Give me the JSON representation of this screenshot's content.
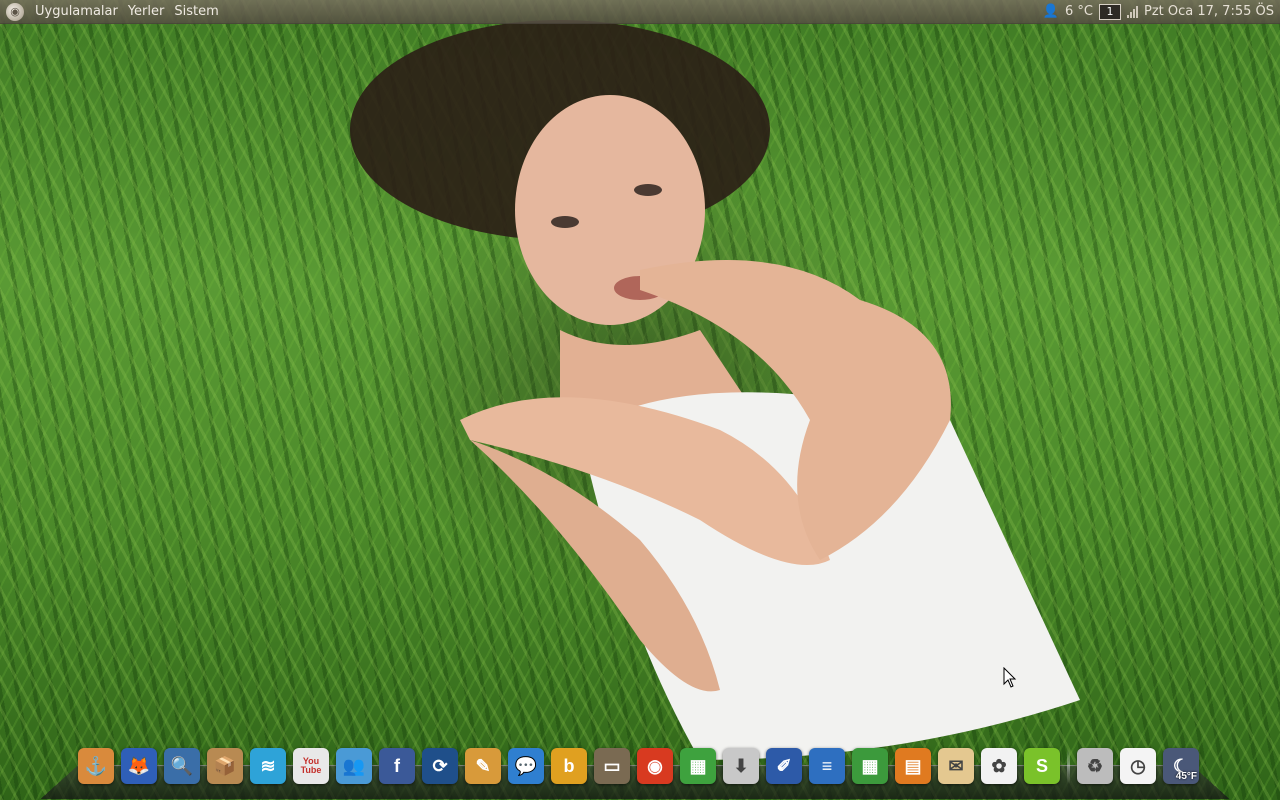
{
  "top_panel": {
    "menus": [
      {
        "label": "Uygulamalar",
        "name": "menu-applications"
      },
      {
        "label": "Yerler",
        "name": "menu-places"
      },
      {
        "label": "Sistem",
        "name": "menu-system"
      }
    ],
    "weather": "6 °C",
    "workspace": "1",
    "clock": "Pzt Oca 17,  7:55 ÖS"
  },
  "dock": {
    "icons": [
      {
        "name": "dock-anchor-icon",
        "glyph": "⚓",
        "color": "#d98a3c"
      },
      {
        "name": "dock-firefox-icon",
        "glyph": "🦊",
        "color": "#2f5fb8"
      },
      {
        "name": "dock-image-search-icon",
        "glyph": "🔍",
        "color": "#3a6ea8"
      },
      {
        "name": "dock-package-icon",
        "glyph": "📦",
        "color": "#b88a52"
      },
      {
        "name": "dock-network-icon",
        "glyph": "≋",
        "color": "#2ea3d8"
      },
      {
        "name": "dock-youtube-icon",
        "glyph": "You Tube",
        "color": "#e8e8e8"
      },
      {
        "name": "dock-messenger-icon",
        "glyph": "👥",
        "color": "#4a9ad6"
      },
      {
        "name": "dock-facebook-icon",
        "glyph": "f",
        "color": "#3b5998"
      },
      {
        "name": "dock-update-icon",
        "glyph": "⟳",
        "color": "#1f4f8a"
      },
      {
        "name": "dock-paint-icon",
        "glyph": "✎",
        "color": "#d89a3a"
      },
      {
        "name": "dock-chat-icon",
        "glyph": "💬",
        "color": "#2f7fd0"
      },
      {
        "name": "dock-bookmark-icon",
        "glyph": "b",
        "color": "#e0a020"
      },
      {
        "name": "dock-tv-icon",
        "glyph": "▭",
        "color": "#7a6a52"
      },
      {
        "name": "dock-media-player-icon",
        "glyph": "◉",
        "color": "#d83a20"
      },
      {
        "name": "dock-sudoku-icon",
        "glyph": "▦",
        "color": "#3ea23e"
      },
      {
        "name": "dock-download-icon",
        "glyph": "⬇",
        "color": "#c8c8c8"
      },
      {
        "name": "dock-writer-draw-icon",
        "glyph": "✐",
        "color": "#2d5aa8"
      },
      {
        "name": "dock-writer-icon",
        "glyph": "≡",
        "color": "#2e6fc0"
      },
      {
        "name": "dock-calc-icon",
        "glyph": "▦",
        "color": "#3c9a3c"
      },
      {
        "name": "dock-impress-icon",
        "glyph": "▤",
        "color": "#e07a20"
      },
      {
        "name": "dock-mail-icon",
        "glyph": "✉",
        "color": "#e4c890"
      },
      {
        "name": "dock-picasa-icon",
        "glyph": "✿",
        "color": "#f2f2f2"
      },
      {
        "name": "dock-skype-icon",
        "glyph": "S",
        "color": "#7ac22a"
      },
      {
        "name": "dock-trash-icon",
        "glyph": "♻",
        "color": "#bcbcbc"
      },
      {
        "name": "dock-clock-icon",
        "glyph": "◷",
        "color": "#f4f4f4"
      },
      {
        "name": "dock-weather-icon",
        "glyph": "☾",
        "color": "#4a5878",
        "temp": "45°F"
      }
    ]
  }
}
